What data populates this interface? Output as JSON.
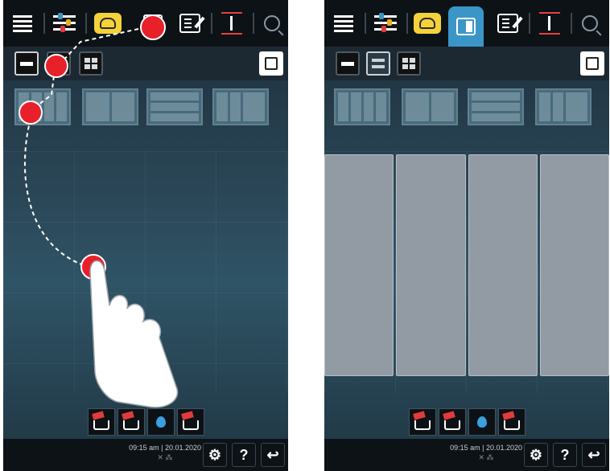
{
  "status": {
    "time": "09:15 am",
    "date": "20.01.2020",
    "help_label": "?"
  },
  "colors": {
    "active_tab": "#3b96c8",
    "chef_icon": "#f4d33a",
    "touch_marker": "#e8202a",
    "zone_fill": "#929aa3"
  },
  "topbar_icons": [
    "menu-icon",
    "sliders-icon",
    "chef-hat-icon",
    "layout-icon",
    "edit-icon",
    "updown-icon",
    "search-icon"
  ],
  "layout_buttons": [
    "single-layout",
    "two-row-layout",
    "quad-layout"
  ],
  "thumbnails": [
    "four-columns",
    "two-columns",
    "three-rows",
    "three-split"
  ],
  "program_buttons": [
    "auto-tray-icon",
    "tray-icon",
    "water-drop-icon",
    "steam-icon"
  ],
  "right_panel_columns": 4
}
